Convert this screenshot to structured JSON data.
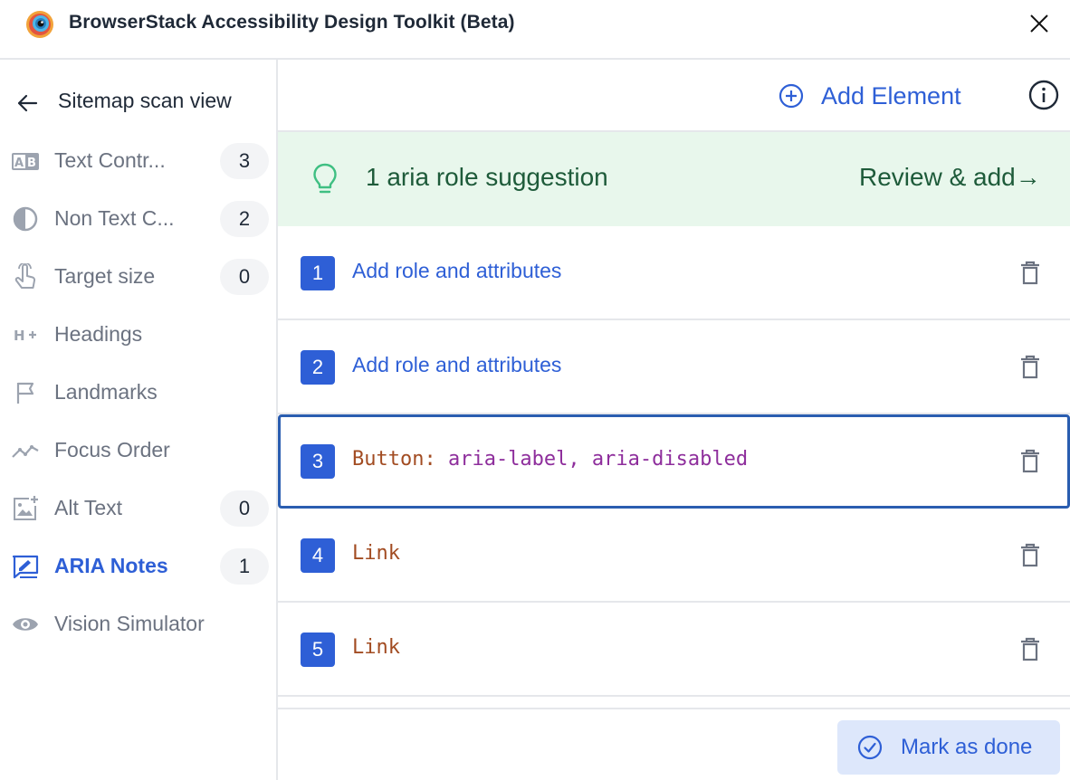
{
  "window": {
    "title": "BrowserStack Accessibility Design Toolkit (Beta)"
  },
  "sidebar": {
    "back_label": "Sitemap scan view",
    "items": [
      {
        "label": "Text Contr...",
        "count": "3",
        "icon": "text-contrast-icon"
      },
      {
        "label": "Non Text C...",
        "count": "2",
        "icon": "half-circle-icon"
      },
      {
        "label": "Target size",
        "count": "0",
        "icon": "pointer-hand-icon"
      },
      {
        "label": "Headings",
        "count": "",
        "icon": "heading-icon"
      },
      {
        "label": "Landmarks",
        "count": "",
        "icon": "flag-icon"
      },
      {
        "label": "Focus Order",
        "count": "",
        "icon": "trend-line-icon"
      },
      {
        "label": "Alt Text",
        "count": "0",
        "icon": "image-add-icon"
      },
      {
        "label": "ARIA Notes",
        "count": "1",
        "icon": "aria-note-icon",
        "active": true
      },
      {
        "label": "Vision Simulator",
        "count": "",
        "icon": "eye-icon"
      }
    ]
  },
  "main": {
    "add_element_label": "Add Element",
    "suggestion": {
      "text": "1 aria role suggestion",
      "action": "Review & add→"
    },
    "rows": [
      {
        "number": "1",
        "action_label": "Add role and attributes"
      },
      {
        "number": "2",
        "action_label": "Add role and attributes"
      },
      {
        "number": "3",
        "role": "Button:",
        "attributes": " aria-label, aria-disabled"
      },
      {
        "number": "4",
        "role": "Link",
        "attributes": ""
      },
      {
        "number": "5",
        "role": "Link",
        "attributes": ""
      }
    ],
    "done_label": "Mark as done"
  },
  "colors": {
    "accent": "#2e5fd6",
    "suggestion_bg": "#e8f7ec",
    "suggestion_text": "#1e5b3a",
    "role_text": "#a24c22",
    "attr_text": "#8e2e9c"
  }
}
